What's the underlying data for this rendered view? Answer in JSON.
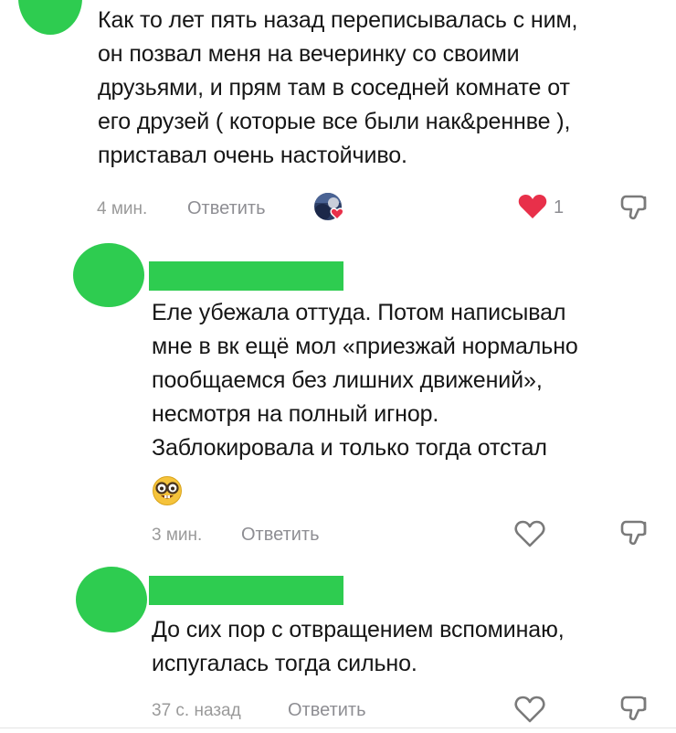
{
  "comments": [
    {
      "text": "Как то лет пять назад переписывалась с ним,\nон позвал меня на вечеринку со своими\nдрузьями, и прям там в соседней комнате от\nего друзей ( которые все были нак&реннве ),\nприставал очень настойчиво.",
      "time": "4 мин.",
      "reply": "Ответить",
      "likes": "1",
      "liked": true
    },
    {
      "text": "Еле убежала оттуда. Потом написывал\nмне в вк ещё мол «приезжай нормально\nпообщаемся без лишних движений»,\nнесмотря на полный игнор.\nЗаблокировала и только тогда отстал",
      "emoji": "nerd-face-emoji",
      "time": "3 мин.",
      "reply": "Ответить",
      "liked": false
    },
    {
      "text": "До сих пор с отвращением вспоминаю,\nиспугалась тогда сильно.",
      "time": "37 с. назад",
      "reply": "Ответить",
      "liked": false
    }
  ],
  "colors": {
    "avatar_placeholder": "#2ecc50",
    "like_red": "#e8304a",
    "meta_gray": "#9a9a9a"
  }
}
